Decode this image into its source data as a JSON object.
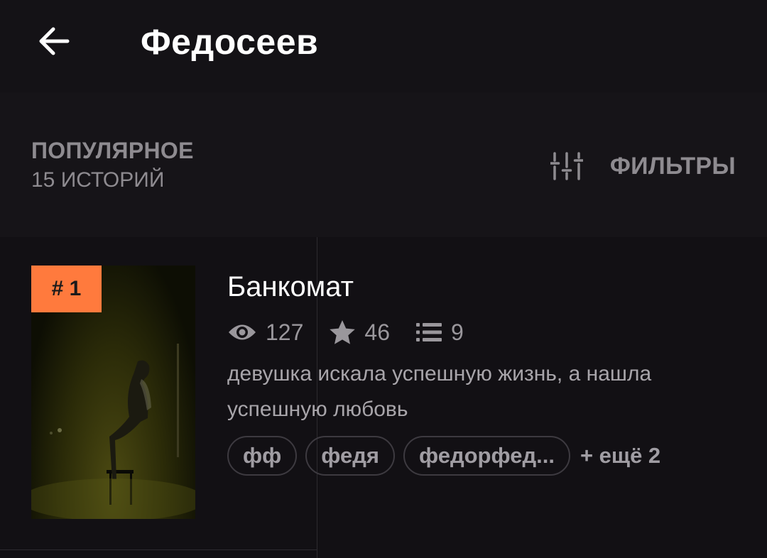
{
  "header": {
    "back_icon": "arrow-left-icon",
    "title": "Федосеев"
  },
  "sort_bar": {
    "sort_label": "ПОПУЛЯРНОЕ",
    "count_label": "15 ИСТОРИЙ",
    "filter_icon": "sliders-icon",
    "filter_label": "ФИЛЬТРЫ"
  },
  "stories": [
    {
      "rank": "# 1",
      "title": "Банкомат",
      "views": "127",
      "votes": "46",
      "parts": "9",
      "description": "девушка искала успешную жизнь, а нашла успешную любовь",
      "tags": [
        "фф",
        "федя",
        "федорфед..."
      ],
      "more_tags": "+ ещё 2"
    }
  ],
  "colors": {
    "background": "#121014",
    "rank_badge": "#ff7a3d",
    "muted_text": "#8e8b90"
  }
}
